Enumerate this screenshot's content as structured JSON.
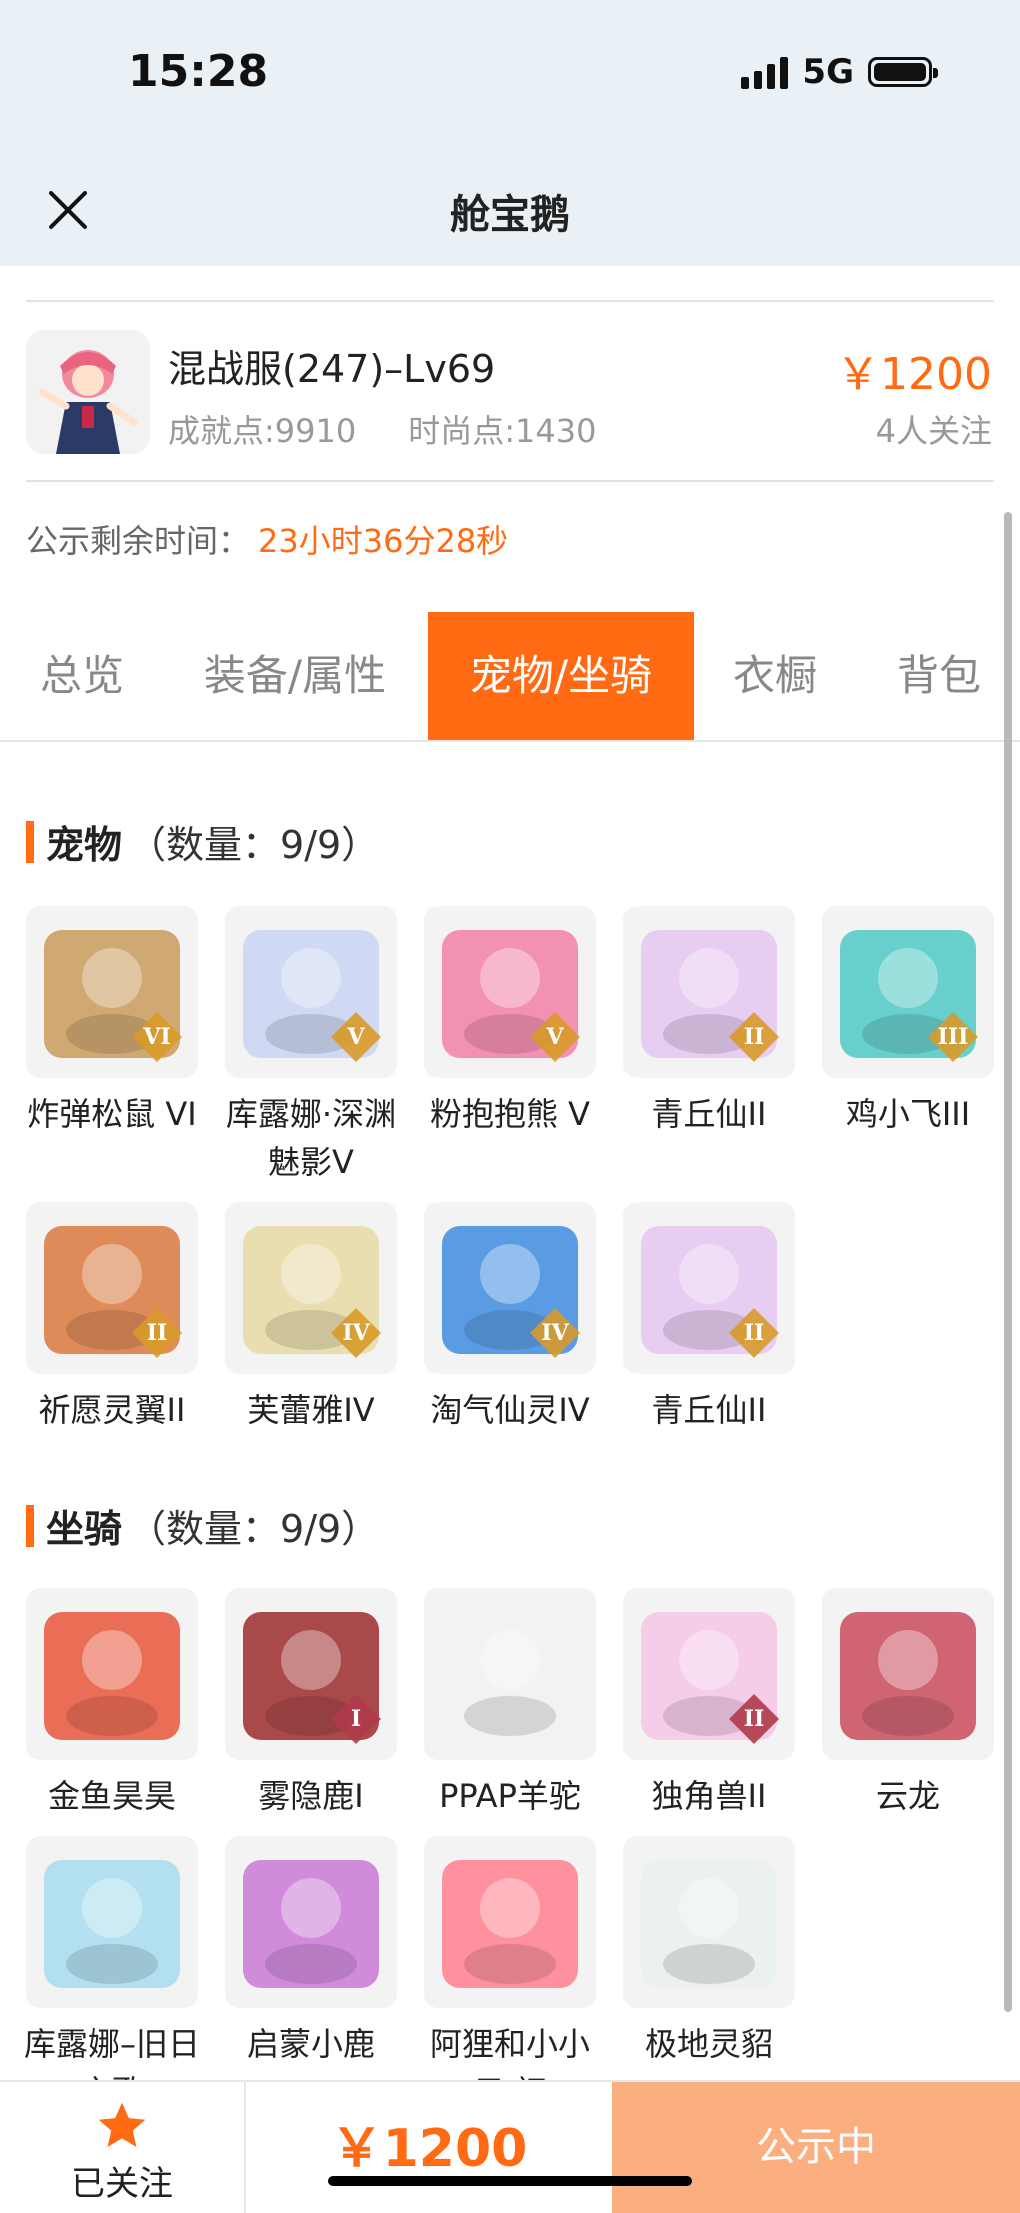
{
  "status_bar": {
    "time": "15:28",
    "network": "5G"
  },
  "header": {
    "title": "舱宝鹅"
  },
  "listing": {
    "server": "混战服(247)–Lv69",
    "achievement": "成就点:9910",
    "fashion": "时尚点:1430",
    "price": "￥1200",
    "followers": "4人关注"
  },
  "countdown": {
    "label": "公示剩余时间：",
    "value": "23小时36分28秒"
  },
  "tabs": [
    "总览",
    "装备/属性",
    "宠物/坐骑",
    "衣橱",
    "背包"
  ],
  "active_tab": 2,
  "pets": {
    "title": "宠物",
    "count": "（数量：9/9）",
    "items": [
      {
        "name": "炸弹松鼠 VI",
        "badge": "VI"
      },
      {
        "name": "库露娜·深渊魅影V",
        "badge": "V"
      },
      {
        "name": "粉抱抱熊 V",
        "badge": "V"
      },
      {
        "name": "青丘仙II",
        "badge": "II"
      },
      {
        "name": "鸡小飞III",
        "badge": "III"
      },
      {
        "name": "祈愿灵翼II",
        "badge": "II"
      },
      {
        "name": "芙蕾雅IV",
        "badge": "IV"
      },
      {
        "name": "淘气仙灵IV",
        "badge": "IV"
      },
      {
        "name": "青丘仙II",
        "badge": "II"
      }
    ]
  },
  "mounts": {
    "title": "坐骑",
    "count": "（数量：9/9）",
    "items": [
      {
        "name": "金鱼昊昊",
        "badge": ""
      },
      {
        "name": "雾隐鹿I",
        "badge": "I"
      },
      {
        "name": "PPAP羊驼",
        "badge": ""
      },
      {
        "name": "独角兽II",
        "badge": "II"
      },
      {
        "name": "云龙",
        "badge": ""
      },
      {
        "name": "库露娜–旧日之歌",
        "badge": ""
      },
      {
        "name": "启蒙小鹿",
        "badge": ""
      },
      {
        "name": "阿狸和小小云·初",
        "badge": ""
      },
      {
        "name": "极地灵貂",
        "badge": ""
      }
    ]
  },
  "bottom_bar": {
    "follow_label": "已关注",
    "price": "￥1200",
    "status": "公示中"
  },
  "colors": {
    "accent": "#ff6a13",
    "header_bg": "#eaf1f6",
    "status_button": "#fbaf80"
  }
}
